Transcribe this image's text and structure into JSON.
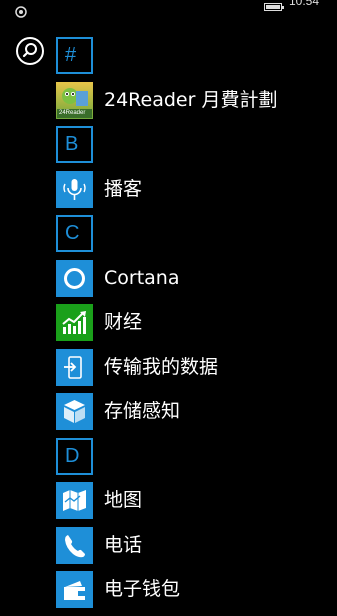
{
  "status": {
    "time": "10:54"
  },
  "colors": {
    "accent": "#1e8fd8",
    "finance": "#1aa01a"
  },
  "search": {
    "icon": "search-icon"
  },
  "apps": [
    {
      "kind": "letter",
      "letter": "#"
    },
    {
      "kind": "app",
      "label": "24Reader 月費計劃",
      "icon": "24reader-icon",
      "tile_text": "24Reader"
    },
    {
      "kind": "letter",
      "letter": "B"
    },
    {
      "kind": "app",
      "label": "播客",
      "icon": "microphone-icon"
    },
    {
      "kind": "letter",
      "letter": "C"
    },
    {
      "kind": "app",
      "label": "Cortana",
      "icon": "cortana-icon"
    },
    {
      "kind": "app",
      "label": "财经",
      "icon": "finance-chart-icon"
    },
    {
      "kind": "app",
      "label": "传输我的数据",
      "icon": "transfer-data-icon"
    },
    {
      "kind": "app",
      "label": "存储感知",
      "icon": "storage-sense-icon"
    },
    {
      "kind": "letter",
      "letter": "D"
    },
    {
      "kind": "app",
      "label": "地图",
      "icon": "map-icon"
    },
    {
      "kind": "app",
      "label": "电话",
      "icon": "phone-icon"
    },
    {
      "kind": "app",
      "label": "电子钱包",
      "icon": "wallet-icon"
    }
  ]
}
